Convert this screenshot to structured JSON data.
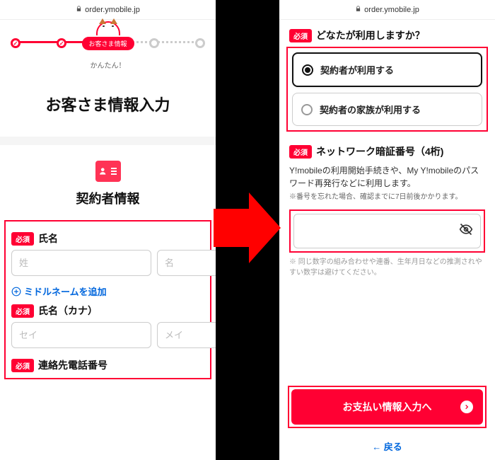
{
  "url": "order.ymobile.jp",
  "stepper": {
    "bubble": "お客さま情報",
    "subtitle": "かんたん！"
  },
  "page_title": "お客さま情報入力",
  "section_contractor": "契約者情報",
  "badges": {
    "required": "必須"
  },
  "left": {
    "name_label": "氏名",
    "sei_ph": "姓",
    "mei_ph": "名",
    "add_middle": "ミドルネームを追加",
    "kana_label": "氏名（カナ）",
    "sei_kana_ph": "セイ",
    "mei_kana_ph": "メイ",
    "phone_label": "連絡先電話番号"
  },
  "right": {
    "who_label": "どなたが利用しますか？",
    "opt1": "契約者が利用する",
    "opt2": "契約者の家族が利用する",
    "pin_label": "ネットワーク暗証番号（4桁)",
    "pin_desc": "Y!mobileの利用開始手続きや、My Y!mobileのパスワード再発行などに利用します。",
    "pin_note": "※番号を忘れた場合、確認までに7日前後かかります。",
    "pin_hint": "※ 同じ数字の組み合わせや連番、生年月日などの推測されやすい数字は避けてください。",
    "cta": "お支払い情報入力へ",
    "back": "← 戻る"
  }
}
